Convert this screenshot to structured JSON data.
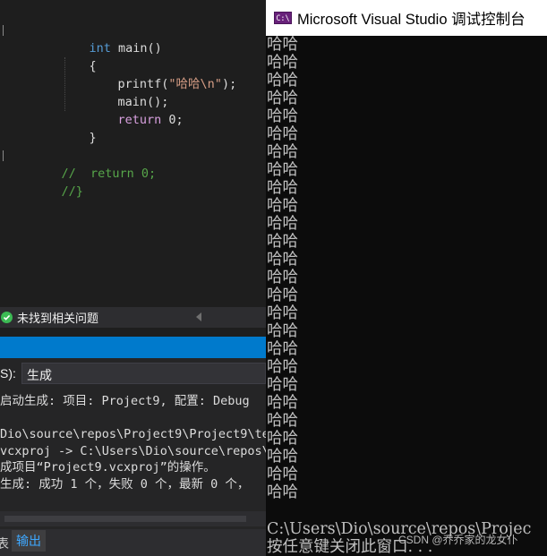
{
  "editor": {
    "lines": [
      {
        "kw": "int",
        "rest": " main()"
      },
      {
        "text": "{"
      },
      {
        "fn": "printf(",
        "str": "\"哈哈\\n\"",
        "end": ");"
      },
      {
        "text": "main();"
      },
      {
        "kw": "return",
        "rest": " 0;"
      },
      {
        "text": "}"
      },
      {
        "comment": "//  return 0;"
      },
      {
        "comment": "//}"
      }
    ]
  },
  "error_list": {
    "status": "未找到相关问题"
  },
  "output": {
    "show_label": "S):",
    "source_value": "生成",
    "lines": [
      "启动生成: 项目: Project9, 配置: Debug",
      "",
      "Dio\\source\\repos\\Project9\\Project9\\tes",
      "vcxproj -> C:\\Users\\Dio\\source\\repos\\P",
      "成项目“Project9.vcxproj”的操作。",
      "生成: 成功 1 个，失败 0 个，最新 0 个，"
    ],
    "tabs": {
      "partial_label": "表",
      "output_label": "输出"
    }
  },
  "console": {
    "icon_text": "C:\\",
    "title": "Microsoft Visual Studio 调试控制台",
    "repeated_line": "哈哈",
    "path_line": "C:\\Users\\Dio\\source\\repos\\Projec",
    "prompt_line": "按任意键关闭此窗口. . .",
    "watermark": "CSDN @乔乔家的龙女仆"
  },
  "colors": {
    "editor_bg": "#1e1e1e",
    "keyword": "#569cd6",
    "string": "#d69d85",
    "comment": "#57a64a",
    "accent_blue": "#007acc",
    "console_bg": "#0c0c0c",
    "success_green": "#3cba54"
  }
}
